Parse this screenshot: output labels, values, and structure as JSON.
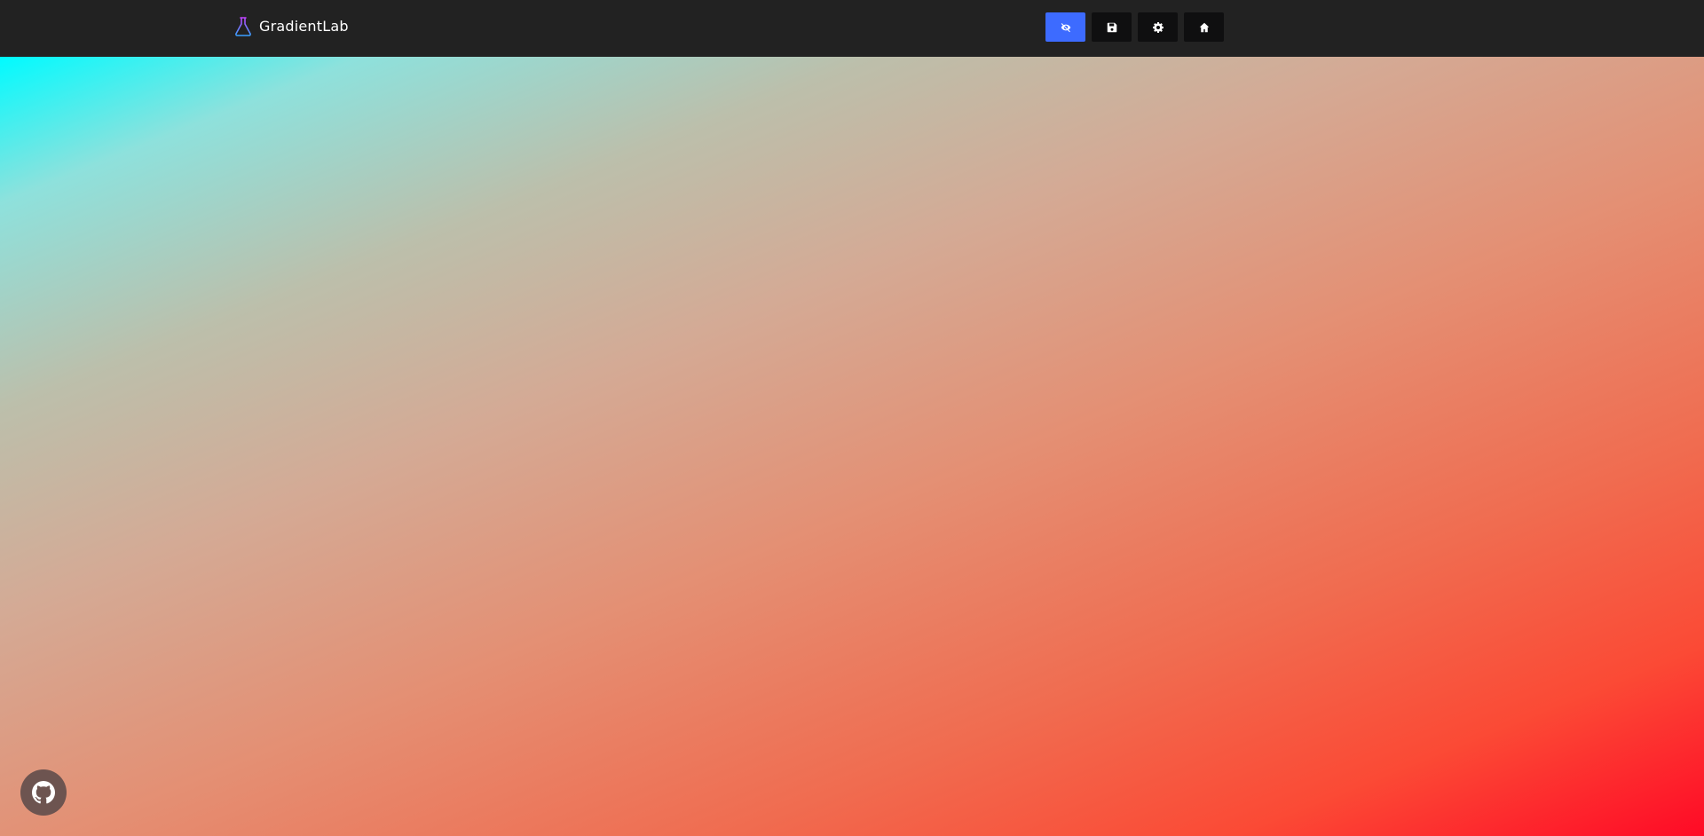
{
  "brand": {
    "name": "GradientLab",
    "logo_icon": "flask-icon"
  },
  "toolbar": {
    "buttons": [
      {
        "icon": "eye-slash-icon",
        "active": true
      },
      {
        "icon": "save-icon",
        "active": false
      },
      {
        "icon": "gear-icon",
        "active": false
      },
      {
        "icon": "home-icon",
        "active": false
      }
    ]
  },
  "gradient": {
    "start_color": "#00fbff",
    "end_color": "#ff0a26"
  },
  "fab": {
    "icon": "github-icon"
  },
  "colors": {
    "topbar": "#222222",
    "accent": "#3d6bff",
    "button": "#0f0f10",
    "fab": "#6d5450"
  }
}
